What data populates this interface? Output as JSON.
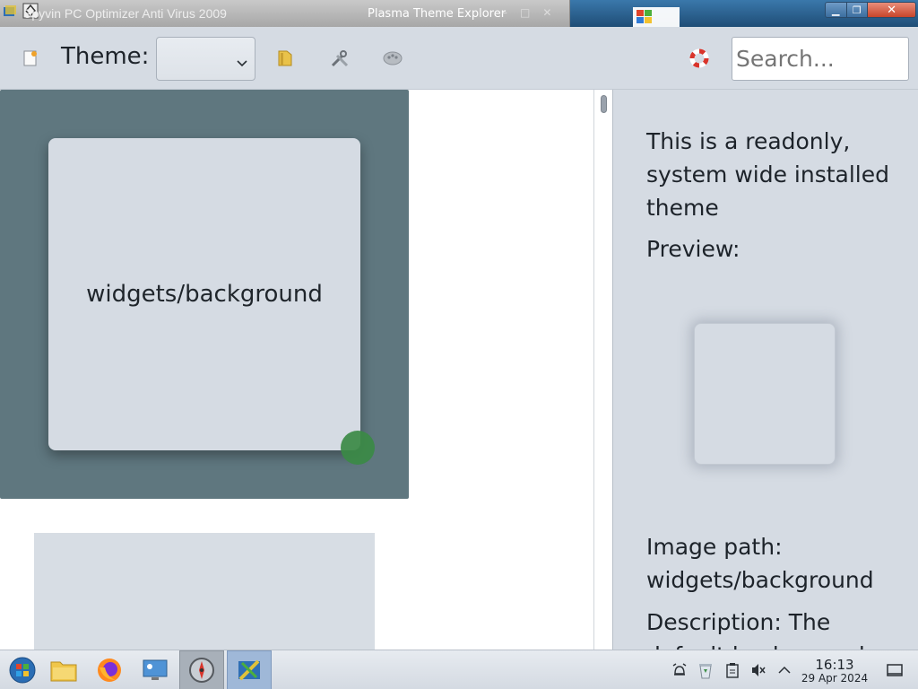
{
  "window": {
    "background_title": "Spyvin PC Optimizer Anti Virus 2009",
    "title": "Plasma Theme Explorer",
    "controls": {
      "minimize": "▁",
      "maximize": "❐",
      "close": "✕"
    }
  },
  "toolbar": {
    "new_theme_icon": "new-document-icon",
    "theme_label": "Theme:",
    "theme_select_value": "",
    "open_folder_icon": "folder-icon",
    "edit_icon": "tools-icon",
    "colors_icon": "palette-icon",
    "help_icon": "lifebuoy-icon",
    "search_placeholder": "Search..."
  },
  "list": {
    "items": [
      {
        "label": "widgets/background",
        "selected": true
      },
      {
        "label": "",
        "selected": false
      }
    ]
  },
  "details": {
    "readonly_note": "This is a readonly, system wide installed theme",
    "preview_label": "Preview:",
    "image_path_label": "Image path:",
    "image_path_value": "widgets/background",
    "description_label": "Description: The",
    "description_cont": "default background"
  },
  "taskbar": {
    "items": [
      "start-orb-icon",
      "file-explorer-icon",
      "firefox-icon",
      "remote-desktop-icon",
      "safari-icon",
      "theme-explorer-icon"
    ],
    "tray": [
      "alarm-icon",
      "recycle-bin-icon",
      "clipboard-icon",
      "muted-speaker-icon",
      "chevron-up-icon"
    ],
    "time": "16:13",
    "date": "29 Apr 2024",
    "show_desktop": "show-desktop-icon"
  },
  "colors": {
    "selected_item": "#5f777f",
    "accent_green": "#3b8a45",
    "panel_bg": "#d5dbe3"
  }
}
